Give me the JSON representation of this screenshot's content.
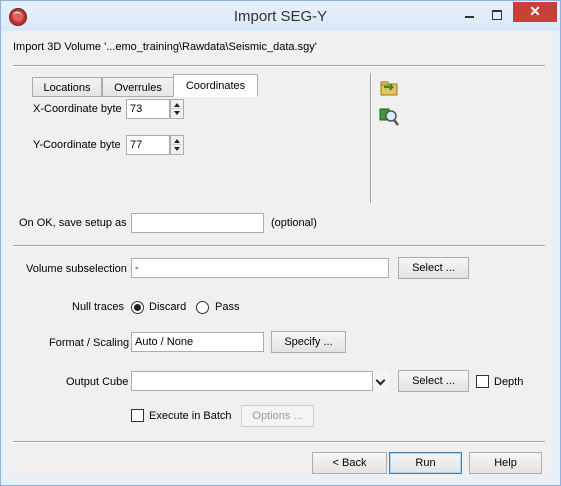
{
  "window": {
    "title": "Import SEG-Y",
    "close_glyph": "✕"
  },
  "header": {
    "text": "Import 3D Volume '...emo_training\\Rawdata\\Seismic_data.sgy'"
  },
  "tabs": [
    {
      "label": "Locations"
    },
    {
      "label": "Overrules"
    },
    {
      "label": "Coordinates"
    }
  ],
  "coordinates": {
    "x_label": "X-Coordinate byte",
    "x_value": "73",
    "y_label": "Y-Coordinate byte",
    "y_value": "77"
  },
  "side_icons": [
    "load-setup-icon",
    "examine-icon"
  ],
  "save_setup": {
    "label": "On OK, save setup as",
    "value": "",
    "hint": "(optional)"
  },
  "volume_subselection": {
    "label": "Volume subselection",
    "value": "-",
    "button": "Select ..."
  },
  "null_traces": {
    "label": "Null traces",
    "options": [
      "Discard",
      "Pass"
    ],
    "selected": "Discard"
  },
  "format_scaling": {
    "label": "Format / Scaling",
    "value": "Auto / None",
    "button": "Specify ..."
  },
  "output_cube": {
    "label": "Output Cube",
    "value": "",
    "button": "Select ...",
    "depth_label": "Depth"
  },
  "batch": {
    "label": "Execute in Batch",
    "options_button": "Options ..."
  },
  "footer": {
    "back": "< Back",
    "run": "Run",
    "help": "Help"
  },
  "colors": {
    "title_bar": "#dbe8f7",
    "close_button": "#c7403a",
    "dialog_bg": "#f0f0f0"
  }
}
